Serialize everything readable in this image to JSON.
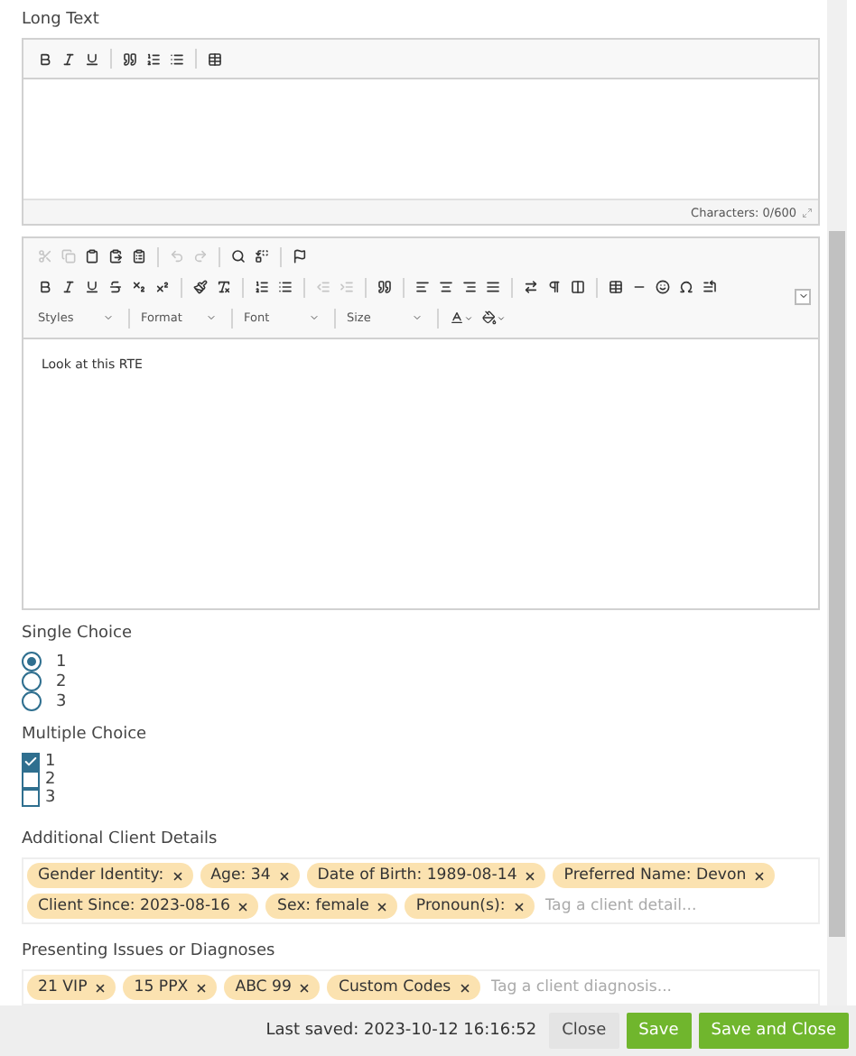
{
  "long_text": {
    "label": "Long Text",
    "toolbar": [
      {
        "disabled": false
      },
      {
        "disabled": false
      },
      {
        "disabled": false
      },
      {
        "disabled": false
      },
      {
        "disabled": false
      },
      {
        "disabled": false
      },
      {
        "disabled": false
      }
    ],
    "counter": "Characters: 0/600"
  },
  "rte": {
    "toolbar_row_1": [
      {
        "disabled": true
      },
      {
        "disabled": true
      },
      {
        "disabled": false
      },
      {
        "disabled": false
      },
      {
        "disabled": false
      },
      {
        "disabled": true
      },
      {
        "disabled": true
      },
      {
        "disabled": false
      },
      {
        "disabled": false
      },
      {
        "disabled": false
      }
    ],
    "toolbar_row_2": [
      {
        "disabled": false
      },
      {
        "disabled": false
      },
      {
        "disabled": false
      },
      {
        "disabled": false
      },
      {
        "disabled": false
      },
      {
        "disabled": false
      },
      {
        "disabled": false
      },
      {
        "disabled": false
      },
      {
        "disabled": false
      },
      {
        "disabled": false
      },
      {
        "disabled": true
      },
      {
        "disabled": true
      },
      {
        "disabled": false
      },
      {
        "disabled": false
      },
      {
        "disabled": false
      },
      {
        "disabled": false
      },
      {
        "disabled": false
      },
      {
        "disabled": false
      },
      {
        "disabled": false
      },
      {
        "disabled": false
      },
      {
        "disabled": false
      },
      {
        "disabled": false
      },
      {
        "disabled": false
      },
      {
        "disabled": false
      },
      {
        "disabled": false
      }
    ],
    "dropdowns": [
      "Styles",
      "Format",
      "Font",
      "Size"
    ],
    "content": "Look at this RTE"
  },
  "single_choice": {
    "label": "Single Choice",
    "options": [
      {
        "label": "1",
        "selected": true
      },
      {
        "label": "2",
        "selected": false
      },
      {
        "label": "3",
        "selected": false
      }
    ]
  },
  "multiple_choice": {
    "label": "Multiple Choice",
    "options": [
      {
        "label": "1",
        "checked": true
      },
      {
        "label": "2",
        "checked": false
      },
      {
        "label": "3",
        "checked": false
      }
    ]
  },
  "client_details": {
    "label": "Additional Client Details",
    "tags": [
      "Gender Identity:",
      "Age: 34",
      "Date of Birth: 1989-08-14",
      "Preferred Name: Devon",
      "Client Since: 2023-08-16",
      "Sex: female",
      "Pronoun(s):"
    ],
    "placeholder": "Tag a client detail..."
  },
  "diagnoses": {
    "label": "Presenting Issues or Diagnoses",
    "tags": [
      "21 VIP",
      "15 PPX",
      "ABC 99",
      "Custom Codes"
    ],
    "placeholder": "Tag a client diagnosis..."
  },
  "footer": {
    "status": "Last saved: 2023-10-12 16:16:52",
    "buttons": [
      {
        "label": "Close",
        "kind": "secondary"
      },
      {
        "label": "Save",
        "kind": "primary"
      },
      {
        "label": "Save and Close",
        "kind": "primary"
      }
    ]
  }
}
